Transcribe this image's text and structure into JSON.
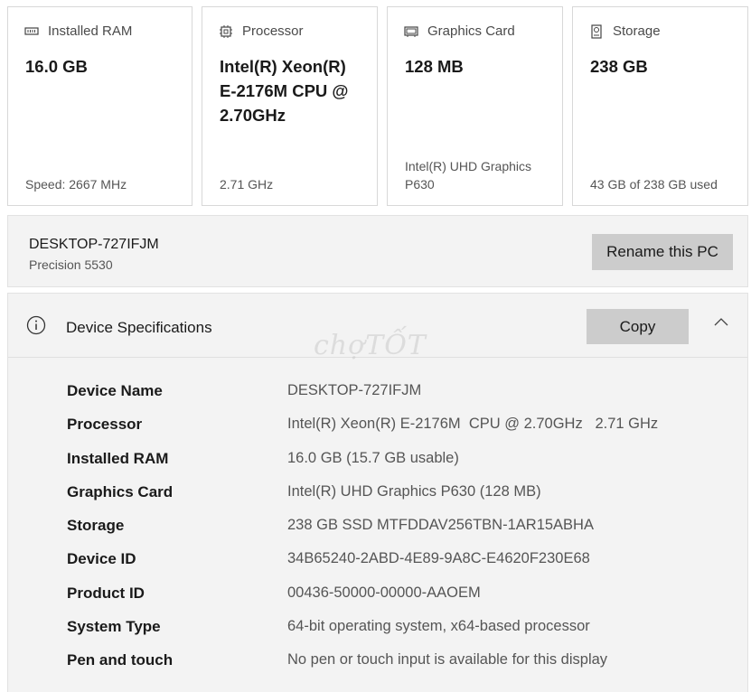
{
  "cards": [
    {
      "title": "Installed RAM",
      "icon": "ram-icon",
      "value": "16.0 GB",
      "sub": "Speed: 2667 MHz"
    },
    {
      "title": "Processor",
      "icon": "processor-icon",
      "value": "Intel(R) Xeon(R)\nE-2176M  CPU @\n2.70GHz",
      "sub": "2.71 GHz"
    },
    {
      "title": "Graphics Card",
      "icon": "graphics-card-icon",
      "value": "128 MB",
      "sub": "Intel(R) UHD Graphics\nP630"
    },
    {
      "title": "Storage",
      "icon": "storage-icon",
      "value": "238 GB",
      "sub": "43 GB of 238 GB used"
    }
  ],
  "pc": {
    "name": "DESKTOP-727IFJM",
    "model": "Precision 5530",
    "rename_label": "Rename this PC"
  },
  "specs": {
    "title": "Device Specifications",
    "copy_label": "Copy",
    "watermark": "chợTỐT",
    "rows": [
      {
        "label": "Device Name",
        "value": "DESKTOP-727IFJM"
      },
      {
        "label": "Processor",
        "value": "Intel(R) Xeon(R) E-2176M  CPU @ 2.70GHz   2.71 GHz"
      },
      {
        "label": "Installed RAM",
        "value": "16.0 GB (15.7 GB usable)"
      },
      {
        "label": "Graphics Card",
        "value": "Intel(R) UHD Graphics P630 (128 MB)"
      },
      {
        "label": "Storage",
        "value": "238 GB SSD MTFDDAV256TBN-1AR15ABHA"
      },
      {
        "label": "Device ID",
        "value": "34B65240-2ABD-4E89-9A8C-E4620F230E68"
      },
      {
        "label": "Product ID",
        "value": "00436-50000-00000-AAOEM"
      },
      {
        "label": "System Type",
        "value": "64-bit operating system, x64-based processor"
      },
      {
        "label": "Pen and touch",
        "value": "No pen or touch input is available for this display"
      }
    ]
  }
}
